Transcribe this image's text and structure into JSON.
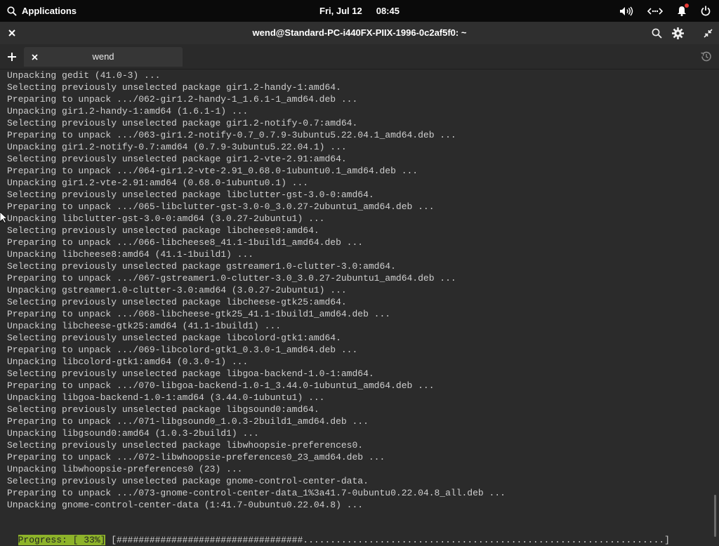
{
  "panel": {
    "apps_label": "Applications",
    "date": "Fri, Jul 12",
    "time": "08:45",
    "icons": [
      "search-icon",
      "volume-icon",
      "network-icon",
      "notification-bell-icon",
      "power-icon"
    ]
  },
  "window": {
    "title": "wend@Standard-PC-i440FX-PIIX-1996-0c2af5f0: ~"
  },
  "tabs": [
    {
      "label": "wend"
    }
  ],
  "terminal": {
    "lines": [
      "Unpacking gedit (41.0-3) ...",
      "Selecting previously unselected package gir1.2-handy-1:amd64.",
      "Preparing to unpack .../062-gir1.2-handy-1_1.6.1-1_amd64.deb ...",
      "Unpacking gir1.2-handy-1:amd64 (1.6.1-1) ...",
      "Selecting previously unselected package gir1.2-notify-0.7:amd64.",
      "Preparing to unpack .../063-gir1.2-notify-0.7_0.7.9-3ubuntu5.22.04.1_amd64.deb ...",
      "Unpacking gir1.2-notify-0.7:amd64 (0.7.9-3ubuntu5.22.04.1) ...",
      "Selecting previously unselected package gir1.2-vte-2.91:amd64.",
      "Preparing to unpack .../064-gir1.2-vte-2.91_0.68.0-1ubuntu0.1_amd64.deb ...",
      "Unpacking gir1.2-vte-2.91:amd64 (0.68.0-1ubuntu0.1) ...",
      "Selecting previously unselected package libclutter-gst-3.0-0:amd64.",
      "Preparing to unpack .../065-libclutter-gst-3.0-0_3.0.27-2ubuntu1_amd64.deb ...",
      "Unpacking libclutter-gst-3.0-0:amd64 (3.0.27-2ubuntu1) ...",
      "Selecting previously unselected package libcheese8:amd64.",
      "Preparing to unpack .../066-libcheese8_41.1-1build1_amd64.deb ...",
      "Unpacking libcheese8:amd64 (41.1-1build1) ...",
      "Selecting previously unselected package gstreamer1.0-clutter-3.0:amd64.",
      "Preparing to unpack .../067-gstreamer1.0-clutter-3.0_3.0.27-2ubuntu1_amd64.deb ...",
      "Unpacking gstreamer1.0-clutter-3.0:amd64 (3.0.27-2ubuntu1) ...",
      "Selecting previously unselected package libcheese-gtk25:amd64.",
      "Preparing to unpack .../068-libcheese-gtk25_41.1-1build1_amd64.deb ...",
      "Unpacking libcheese-gtk25:amd64 (41.1-1build1) ...",
      "Selecting previously unselected package libcolord-gtk1:amd64.",
      "Preparing to unpack .../069-libcolord-gtk1_0.3.0-1_amd64.deb ...",
      "Unpacking libcolord-gtk1:amd64 (0.3.0-1) ...",
      "Selecting previously unselected package libgoa-backend-1.0-1:amd64.",
      "Preparing to unpack .../070-libgoa-backend-1.0-1_3.44.0-1ubuntu1_amd64.deb ...",
      "Unpacking libgoa-backend-1.0-1:amd64 (3.44.0-1ubuntu1) ...",
      "Selecting previously unselected package libgsound0:amd64.",
      "Preparing to unpack .../071-libgsound0_1.0.3-2build1_amd64.deb ...",
      "Unpacking libgsound0:amd64 (1.0.3-2build1) ...",
      "Selecting previously unselected package libwhoopsie-preferences0.",
      "Preparing to unpack .../072-libwhoopsie-preferences0_23_amd64.deb ...",
      "Unpacking libwhoopsie-preferences0 (23) ...",
      "Selecting previously unselected package gnome-control-center-data.",
      "Preparing to unpack .../073-gnome-control-center-data_1%3a41.7-0ubuntu0.22.04.8_all.deb ...",
      "Unpacking gnome-control-center-data (1:41.7-0ubuntu0.22.04.8) ..."
    ],
    "progress_label": "Progress: [ 33%]",
    "progress_bar": " [##################################..................................................................]",
    "progress_percent": 33
  },
  "colors": {
    "progress_label_bg": "#8db32a",
    "terminal_bg": "#2b2b2b",
    "panel_bg": "#0a0a0a"
  }
}
